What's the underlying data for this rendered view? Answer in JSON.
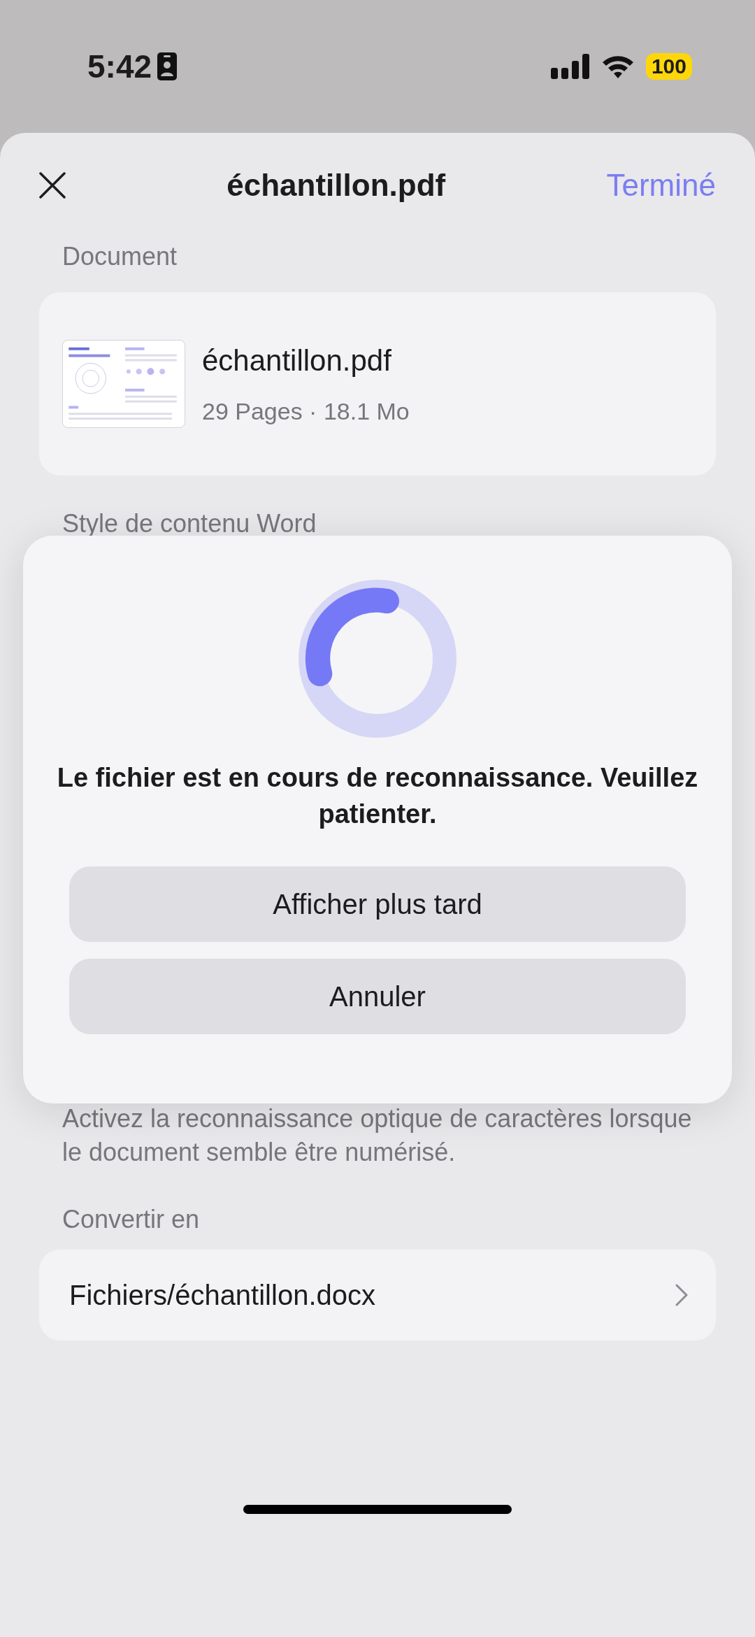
{
  "status_bar": {
    "time": "5:42",
    "battery": "100"
  },
  "header": {
    "title": "échantillon.pdf",
    "done": "Terminé"
  },
  "document_section": {
    "label": "Document",
    "file": {
      "name": "échantillon.pdf",
      "meta": "29 Pages · 18.1 Mo"
    }
  },
  "style_section": {
    "label": "Style de contenu Word"
  },
  "dialog": {
    "message": "Le fichier est en cours de reconnaissance. Veuillez patienter.",
    "buttons": [
      "Afficher plus tard",
      "Annuler"
    ]
  },
  "ocr_note": "Activez la reconnaissance optique de caractères lorsque le document semble être numérisé.",
  "convert_section": {
    "label": "Convertir en",
    "path": "Fichiers/échantillon.docx"
  }
}
